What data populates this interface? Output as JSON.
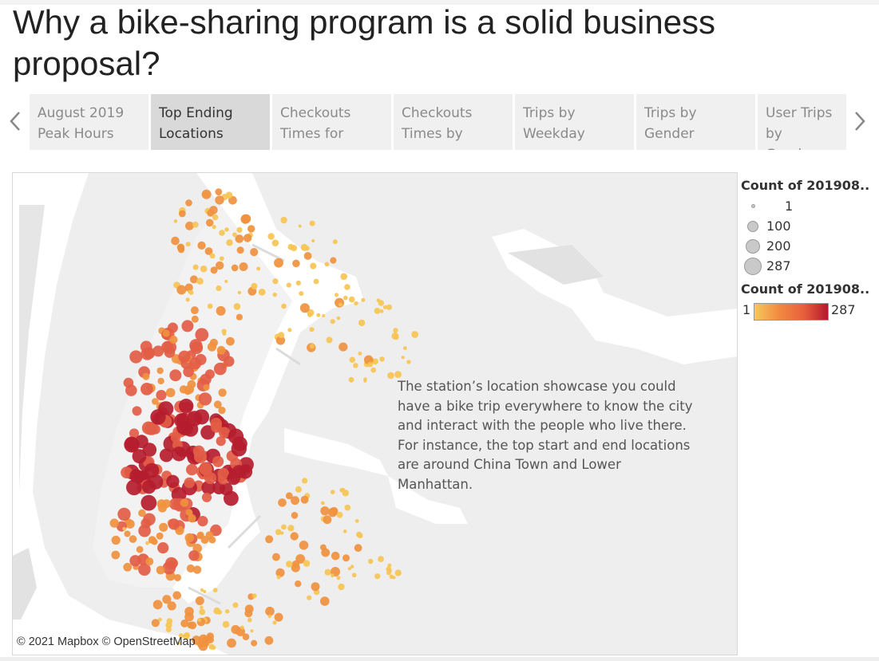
{
  "title": "Why a bike-sharing program is a solid business proposal?",
  "tabs": [
    {
      "label": "August 2019\nPeak Hours",
      "active": false
    },
    {
      "label": "Top Ending\nLocations",
      "active": true
    },
    {
      "label": "Checkouts\nTimes for",
      "active": false
    },
    {
      "label": "Checkouts\nTimes by",
      "active": false
    },
    {
      "label": "Trips by\nWeekday",
      "active": false
    },
    {
      "label": "Trips by\nGender",
      "active": false
    },
    {
      "label": "User Trips by\nGender",
      "active": false
    }
  ],
  "map": {
    "annotation": "The station’s location showcase you could have a bike trip everywhere to know the city and interact with the people who live there. For instance, the top start and end locations are around China Town and Lower Manhattan.",
    "attribution": "© 2021 Mapbox © OpenStreetMap"
  },
  "legend": {
    "size_title": "Count of 201908..",
    "size_items": [
      "1",
      "100",
      "200",
      "287"
    ],
    "color_title": "Count of 201908..",
    "color_min": "1",
    "color_max": "287",
    "color_stops": [
      "#f6c85f",
      "#f28a40",
      "#e8603c",
      "#b5172e"
    ]
  },
  "colors": {
    "low": "#f6c453",
    "mid": "#f0913e",
    "high": "#e35d46",
    "max": "#b51d2f",
    "water": "#ffffff",
    "land": "#eeeeee"
  },
  "icons": {
    "prev": "chevron-left-icon",
    "next": "chevron-right-icon"
  }
}
